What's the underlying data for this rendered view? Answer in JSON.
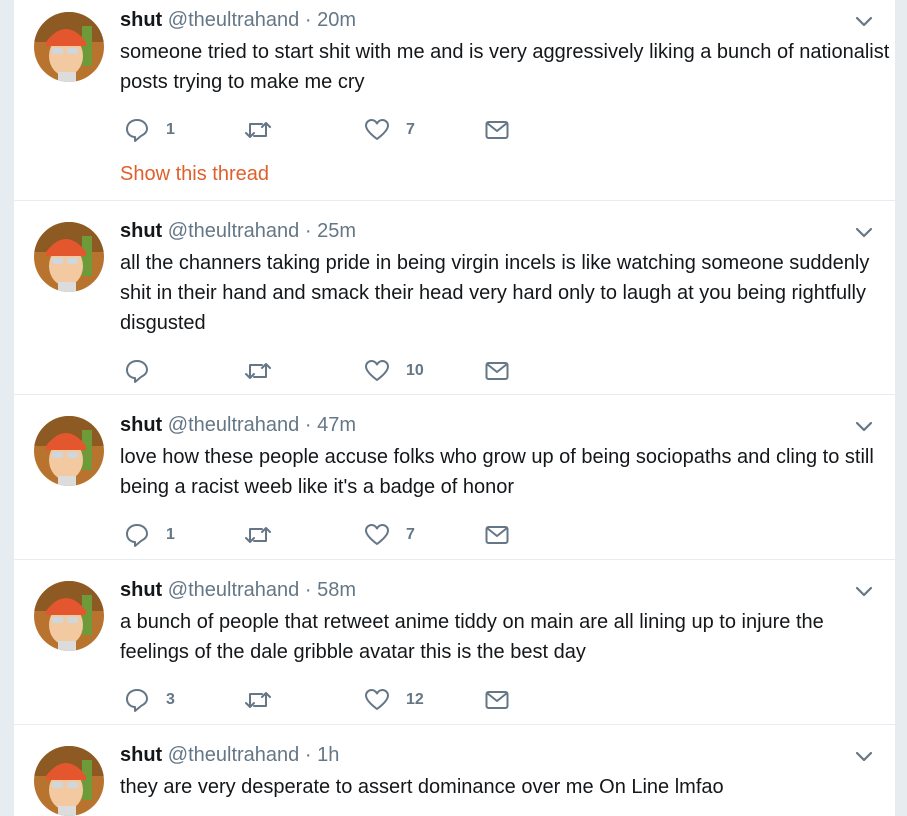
{
  "colors": {
    "link_accent": "#e0602c",
    "text_primary": "#14171a",
    "text_secondary": "#657786",
    "divider": "#e6ecf0"
  },
  "icons": [
    "reply-icon",
    "retweet-icon",
    "like-icon",
    "message-icon",
    "chevron-down-icon"
  ],
  "tweets": [
    {
      "name": "shut",
      "handle": "@theultrahand",
      "separator": "·",
      "time": "20m",
      "text": "someone tried to start shit with me and is very aggressively liking a bunch of nationalist posts trying to make me cry",
      "replies": "1",
      "retweets": "",
      "likes": "7",
      "show_thread": "Show this thread"
    },
    {
      "name": "shut",
      "handle": "@theultrahand",
      "separator": "·",
      "time": "25m",
      "text": "all the channers taking pride in being virgin incels is like watching someone suddenly shit in their hand and smack their head very hard only to laugh at you being rightfully disgusted",
      "replies": "",
      "retweets": "",
      "likes": "10"
    },
    {
      "name": "shut",
      "handle": "@theultrahand",
      "separator": "·",
      "time": "47m",
      "text": "love how these people accuse folks who grow up of being sociopaths and cling to still being a racist weeb like it's a badge of honor",
      "replies": "1",
      "retweets": "",
      "likes": "7"
    },
    {
      "name": "shut",
      "handle": "@theultrahand",
      "separator": "·",
      "time": "58m",
      "text": "a bunch of people that retweet anime tiddy on main are all lining up to injure the feelings of the dale gribble avatar this is the best day",
      "replies": "3",
      "retweets": "",
      "likes": "12"
    },
    {
      "name": "shut",
      "handle": "@theultrahand",
      "separator": "·",
      "time": "1h",
      "text": "they are very desperate to assert dominance over me On Line lmfao"
    }
  ]
}
